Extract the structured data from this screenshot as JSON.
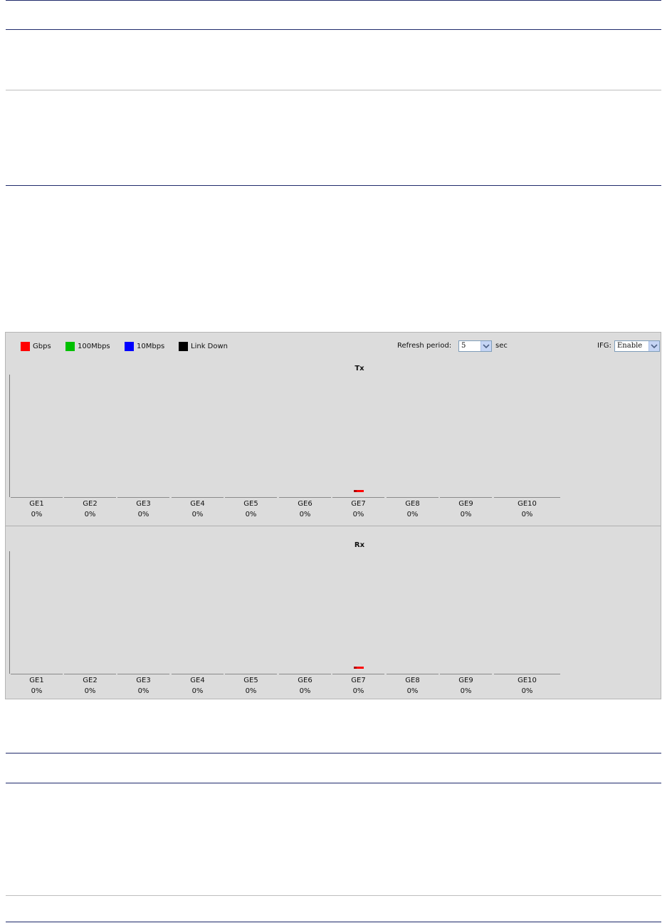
{
  "legend": [
    {
      "label": "Gbps",
      "color": "#ff0000"
    },
    {
      "label": "100Mbps",
      "color": "#00c000"
    },
    {
      "label": "10Mbps",
      "color": "#0000ff"
    },
    {
      "label": "Link Down",
      "color": "#000000"
    }
  ],
  "controls": {
    "refresh_label": "Refresh period:",
    "refresh_value": "5",
    "refresh_unit": "sec",
    "ifg_label": "IFG:",
    "ifg_value": "Enable"
  },
  "charts": [
    {
      "title": "Tx",
      "ports": [
        {
          "name": "GE1",
          "percent": "0%"
        },
        {
          "name": "GE2",
          "percent": "0%"
        },
        {
          "name": "GE3",
          "percent": "0%"
        },
        {
          "name": "GE4",
          "percent": "0%"
        },
        {
          "name": "GE5",
          "percent": "0%"
        },
        {
          "name": "GE6",
          "percent": "0%"
        },
        {
          "name": "GE7",
          "percent": "0%"
        },
        {
          "name": "GE8",
          "percent": "0%"
        },
        {
          "name": "GE9",
          "percent": "0%"
        },
        {
          "name": "GE10",
          "percent": "0%"
        }
      ]
    },
    {
      "title": "Rx",
      "ports": [
        {
          "name": "GE1",
          "percent": "0%"
        },
        {
          "name": "GE2",
          "percent": "0%"
        },
        {
          "name": "GE3",
          "percent": "0%"
        },
        {
          "name": "GE4",
          "percent": "0%"
        },
        {
          "name": "GE5",
          "percent": "0%"
        },
        {
          "name": "GE6",
          "percent": "0%"
        },
        {
          "name": "GE7",
          "percent": "0%"
        },
        {
          "name": "GE8",
          "percent": "0%"
        },
        {
          "name": "GE9",
          "percent": "0%"
        },
        {
          "name": "GE10",
          "percent": "0%"
        }
      ]
    }
  ],
  "active_port": {
    "name": "GE7",
    "speed_color": "#ff0000"
  }
}
